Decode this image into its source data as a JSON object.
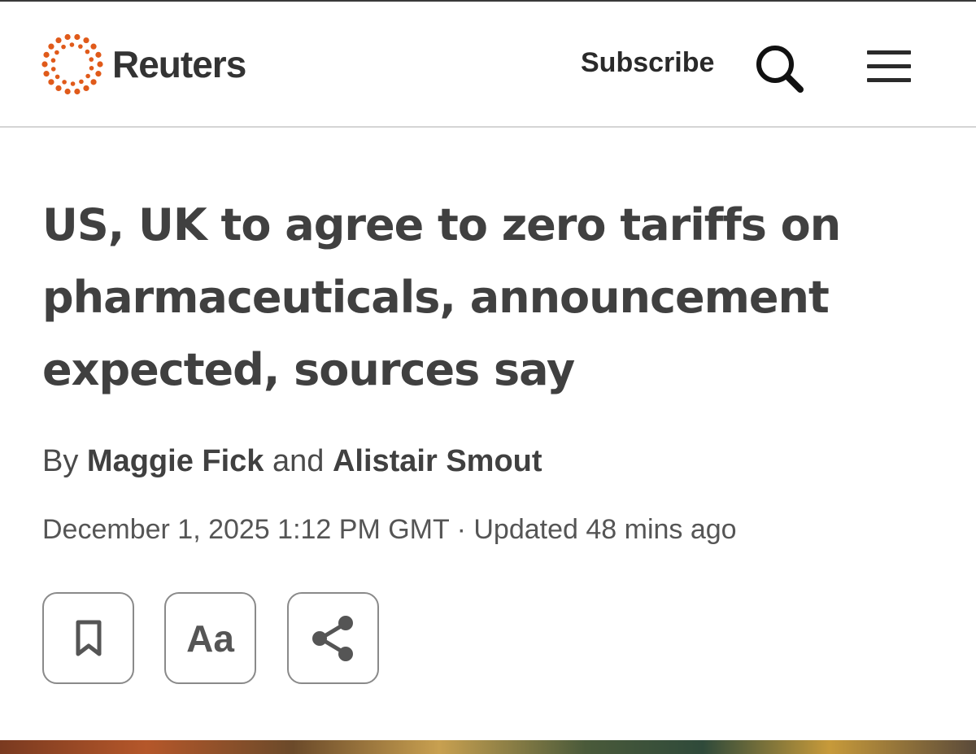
{
  "header": {
    "brand": "Reuters",
    "subscribe_label": "Subscribe",
    "icons": {
      "logo": "reuters-dot-ring-logo",
      "search": "search-icon",
      "menu": "hamburger-menu-icon"
    },
    "brand_color": "#e05a1a"
  },
  "article": {
    "headline": "US, UK to agree to zero tariffs on pharmaceuticals, announcement expected, sources say",
    "byline": {
      "prefix": "By",
      "author1": "Maggie Fick",
      "conjunction": "and",
      "author2": "Alistair Smout"
    },
    "dateline": "December 1, 2025 1:12 PM GMT · Updated 48 mins ago"
  },
  "toolbar": {
    "bookmark_icon": "bookmark-icon",
    "text_size_label": "Aa",
    "share_icon": "share-icon"
  }
}
